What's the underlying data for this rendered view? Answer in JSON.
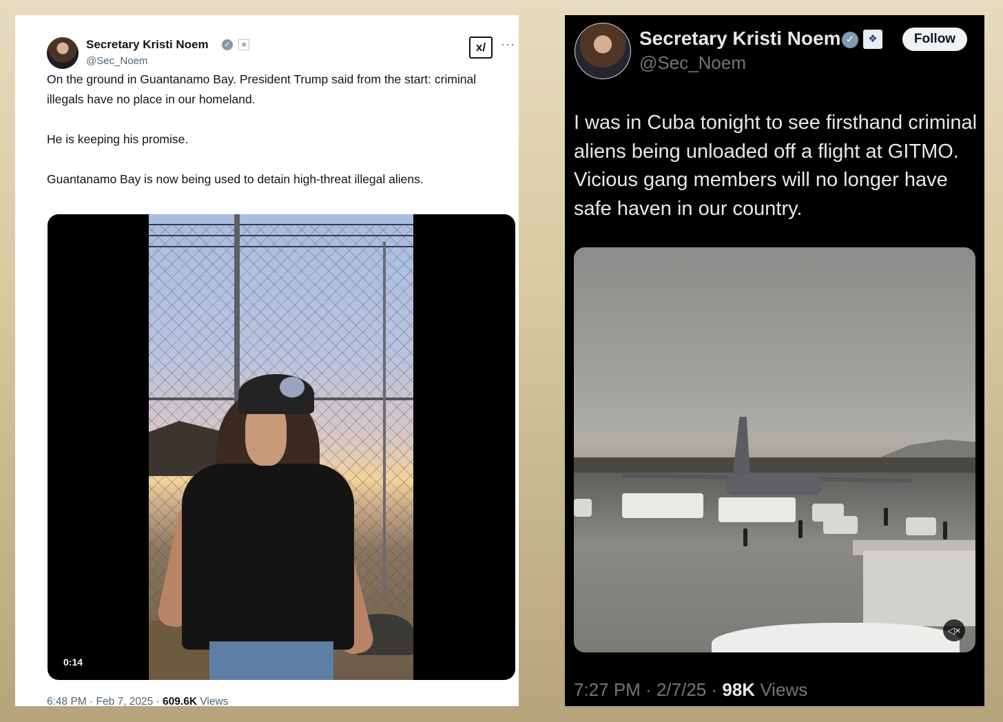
{
  "left_tweet": {
    "author_name": "Secretary Kristi Noem",
    "handle": "@Sec_Noem",
    "paragraphs": [
      "On the ground in Guantanamo Bay. President Trump said from the start: criminal illegals have no place in our homeland.",
      "He is keeping his promise.",
      "Guantanamo Bay is now being used to detain high-threat illegal aliens."
    ],
    "video_duration": "0:14",
    "time": "6:48 PM",
    "date": "Feb 7, 2025",
    "views_count": "609.6K",
    "views_label": "Views",
    "icons": [
      "verified-badge-icon",
      "dhs-affiliate-icon",
      "grok-icon",
      "more-icon"
    ]
  },
  "right_tweet": {
    "author_name": "Secretary Kristi Noem",
    "handle": "@Sec_Noem",
    "follow_label": "Follow",
    "text": "I was in Cuba tonight to see firsthand criminal aliens being unloaded off a flight at GITMO. Vicious gang members will no longer have safe haven in our country.",
    "time": "7:27 PM",
    "date": "2/7/25",
    "views_count": "98K",
    "views_label": "Views",
    "icons": [
      "verified-badge-icon",
      "dhs-affiliate-icon",
      "mute-icon"
    ]
  },
  "colors": {
    "background_gold": "#d8c9a0",
    "left_bg": "#ffffff",
    "right_bg": "#000000",
    "text_dark": "#0f1419",
    "text_light": "#e7e9ea",
    "muted": "#536471",
    "muted_dark": "#71767b"
  }
}
